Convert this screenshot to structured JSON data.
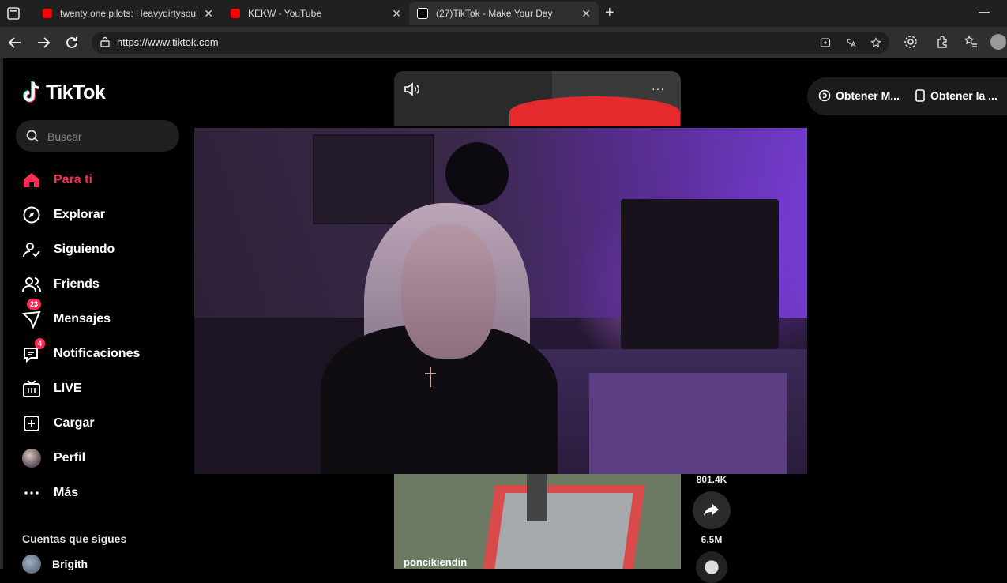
{
  "browser": {
    "tabs": [
      {
        "title": "twenty one pilots: Heavydirtysoul",
        "favicon_color": "#ff0000"
      },
      {
        "title": "KEKW - YouTube",
        "favicon_color": "#ff0000"
      },
      {
        "title": "(27)TikTok - Make Your Day",
        "favicon_color": "#ffffff"
      }
    ],
    "new_tab": "+",
    "close": "✕",
    "minimize": "—",
    "url": "https://www.tiktok.com"
  },
  "brand": {
    "name": "TikTok",
    "accent": "#fe2c55",
    "cyan": "#25f4ee"
  },
  "search": {
    "placeholder": "Buscar"
  },
  "nav": [
    {
      "label": "Para ti",
      "icon": "home-icon",
      "active": true
    },
    {
      "label": "Explorar",
      "icon": "compass-icon"
    },
    {
      "label": "Siguiendo",
      "icon": "following-icon"
    },
    {
      "label": "Friends",
      "icon": "friends-icon"
    },
    {
      "label": "Mensajes",
      "icon": "messages-icon",
      "badge": "23"
    },
    {
      "label": "Notificaciones",
      "icon": "notifications-icon",
      "badge": "4"
    },
    {
      "label": "LIVE",
      "icon": "live-icon"
    },
    {
      "label": "Cargar",
      "icon": "upload-icon"
    },
    {
      "label": "Perfil",
      "icon": "profile-avatar"
    },
    {
      "label": "Más",
      "icon": "more-icon"
    }
  ],
  "following": {
    "title": "Cuentas que sigues",
    "accounts": [
      {
        "name": "Brigith"
      }
    ]
  },
  "video_top": {
    "more": "···"
  },
  "video_bottom": {
    "username": "poncikiendin"
  },
  "actions": {
    "count_top": "801.4K",
    "share_count": "6.5M"
  },
  "header_buttons": {
    "get_coins": "Obtener M...",
    "get_app": "Obtener la ..."
  }
}
